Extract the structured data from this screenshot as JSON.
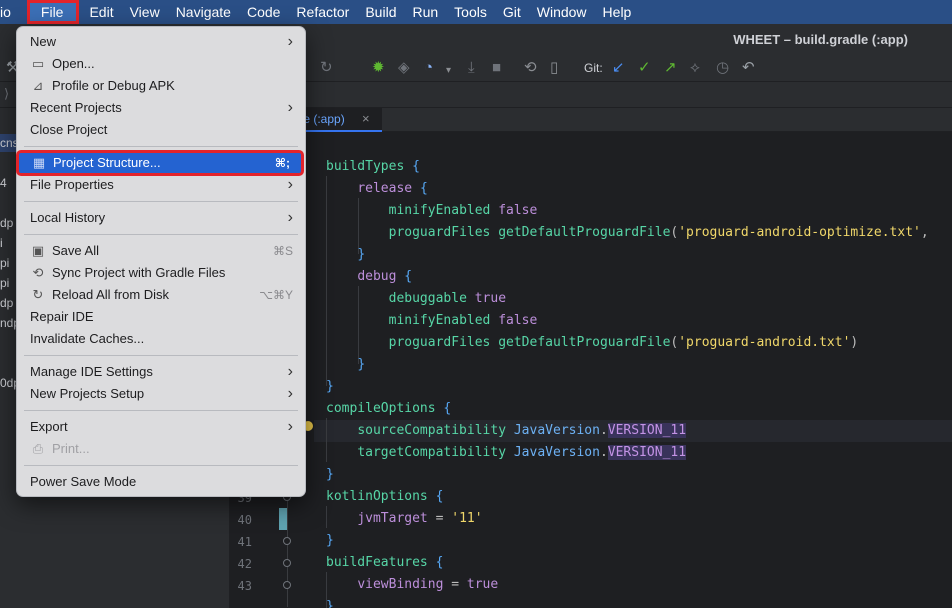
{
  "menubar": {
    "app_fragment": "io",
    "items": [
      "File",
      "Edit",
      "View",
      "Navigate",
      "Code",
      "Refactor",
      "Build",
      "Run",
      "Tools",
      "Git",
      "Window",
      "Help"
    ]
  },
  "window": {
    "title": "WHEET – build.gradle (:app)"
  },
  "toolbar": {
    "git_label": "Git:"
  },
  "editor_tab": {
    "label": "dle (:app)",
    "close": "×"
  },
  "sidepanel": {
    "fragments": [
      "cns",
      "4",
      "dp",
      "i",
      "pi",
      "pi",
      "dp",
      "ndp",
      "0dp"
    ]
  },
  "file_menu": {
    "items": [
      {
        "label": "New",
        "submenu": "›"
      },
      {
        "label": "Open..."
      },
      {
        "label": "Profile or Debug APK"
      },
      {
        "label": "Recent Projects",
        "submenu": "›"
      },
      {
        "label": "Close Project"
      },
      {
        "label": "Project Structure...",
        "shortcut": "⌘;",
        "selected": true
      },
      {
        "label": "File Properties",
        "submenu": "›"
      },
      {
        "label": "Local History",
        "submenu": "›"
      },
      {
        "label": "Save All",
        "shortcut": "⌘S"
      },
      {
        "label": "Sync Project with Gradle Files"
      },
      {
        "label": "Reload All from Disk",
        "shortcut": "⌥⌘Y"
      },
      {
        "label": "Repair IDE"
      },
      {
        "label": "Invalidate Caches..."
      },
      {
        "label": "Manage IDE Settings",
        "submenu": "›"
      },
      {
        "label": "New Projects Setup",
        "submenu": "›"
      },
      {
        "label": "Export",
        "submenu": "›"
      },
      {
        "label": "Print...",
        "disabled": true
      },
      {
        "label": "Power Save Mode"
      }
    ]
  },
  "gutter": {
    "line_numbers": [
      "39",
      "40",
      "41",
      "42",
      "43"
    ]
  },
  "code": {
    "l1_name": "buildTypes",
    "l2_name": "release",
    "l3_name": "minifyEnabled",
    "l3_val": "false",
    "l4_name": "proguardFiles",
    "l4_fn": "getDefaultProguardFile",
    "l4_str": "'proguard-android-optimize.txt'",
    "l4_tail": ",",
    "l6_name": "debug",
    "l7_name": "debuggable",
    "l7_val": "true",
    "l8_name": "minifyEnabled",
    "l8_val": "false",
    "l9_name": "proguardFiles",
    "l9_fn": "getDefaultProguardFile",
    "l9_str": "'proguard-android.txt'",
    "l12_name": "compileOptions",
    "l13_name": "sourceCompatibility",
    "l13_cls": "JavaVersion",
    "l13_const": "VERSION_11",
    "l14_name": "targetCompatibility",
    "l14_cls": "JavaVersion",
    "l14_const": "VERSION_11",
    "l16_name": "kotlinOptions",
    "l17_name": "jvmTarget",
    "l17_eq": "=",
    "l17_str": "'11'",
    "l19_name": "buildFeatures",
    "l20_name": "viewBinding",
    "l20_eq": "=",
    "l20_val": "true",
    "open_brace": "{",
    "close_brace": "}",
    "lparen": "(",
    "rparen": ")",
    "dot": "."
  }
}
